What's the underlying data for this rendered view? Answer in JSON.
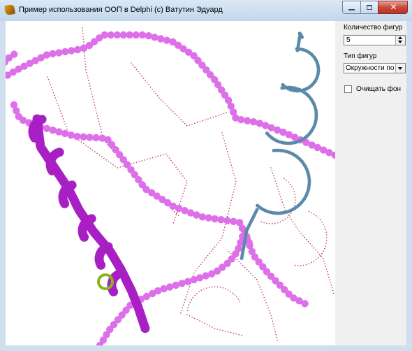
{
  "window": {
    "title": "Пример использования ООП в Delphi (c) Ватутин Эдуард",
    "close_glyph": "✕"
  },
  "panel": {
    "count_label": "Количество фигур",
    "count_value": "5",
    "type_label": "Тип фигур",
    "type_value": "Окружности по спирали",
    "clear_label": "Очищать фон",
    "clear_checked": false
  },
  "canvas": {
    "colors": {
      "pink": "#dd70e8",
      "purple": "#a81fc4",
      "steel": "#5a8aa8",
      "green": "#8ab41a",
      "trail": "#c0306a"
    }
  }
}
